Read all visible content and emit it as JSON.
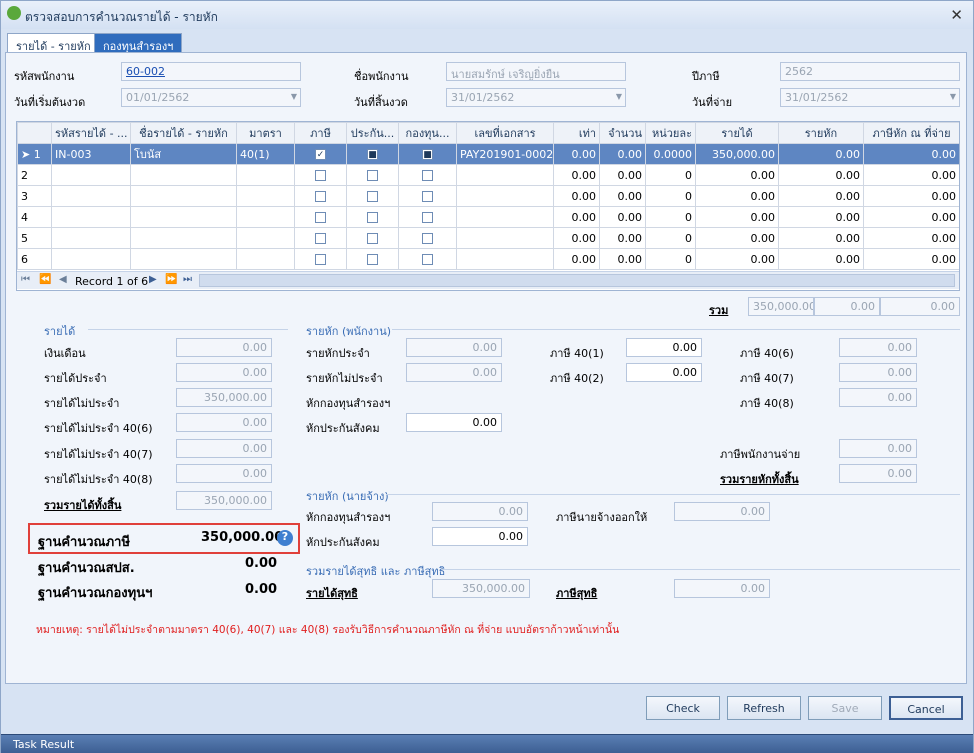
{
  "window": {
    "title": "ตรวจสอบการคำนวณรายได้ - รายหัก",
    "close": "✕"
  },
  "tabs": [
    {
      "label": "รายได้ - รายหัก"
    },
    {
      "label": "กองทุนสำรองฯ"
    }
  ],
  "header": {
    "emp_code_label": "รหัสพนักงาน",
    "emp_code": "60-002",
    "emp_name_label": "ชื่อพนักงาน",
    "emp_name": "นายสมรักษ์ เจริญยิ่งยืน",
    "tax_year_label": "ปีภาษี",
    "tax_year": "2562",
    "start_label": "วันที่เริ่มต้นงวด",
    "start": "01/01/2562",
    "end_label": "วันที่สิ้นงวด",
    "end": "31/01/2562",
    "pay_label": "วันที่จ่าย",
    "pay": "31/01/2562"
  },
  "grid": {
    "columns": [
      "รหัสรายได้ - ...",
      "ชื่อรายได้ - รายหัก",
      "มาตรา",
      "ภาษี",
      "ประกัน...",
      "กองทุน...",
      "เลขที่เอกสาร",
      "เท่า",
      "จำนวน",
      "หน่วยละ",
      "รายได้",
      "รายหัก",
      "ภาษีหัก ณ ที่จ่าย"
    ],
    "rows": [
      {
        "n": "1",
        "code": "IN-003",
        "name": "โบนัส",
        "sec": "40(1)",
        "tax": true,
        "ins": true,
        "fund": true,
        "doc": "PAY201901-0002",
        "times": "0.00",
        "qty": "0.00",
        "unit": "0.0000",
        "inc": "350,000.00",
        "ded": "0.00",
        "wht": "0.00"
      },
      {
        "n": "2",
        "code": "",
        "name": "",
        "sec": "",
        "tax": false,
        "ins": false,
        "fund": false,
        "doc": "",
        "times": "0.00",
        "qty": "0.00",
        "unit": "0",
        "inc": "0.00",
        "ded": "0.00",
        "wht": "0.00"
      },
      {
        "n": "3",
        "code": "",
        "name": "",
        "sec": "",
        "tax": false,
        "ins": false,
        "fund": false,
        "doc": "",
        "times": "0.00",
        "qty": "0.00",
        "unit": "0",
        "inc": "0.00",
        "ded": "0.00",
        "wht": "0.00"
      },
      {
        "n": "4",
        "code": "",
        "name": "",
        "sec": "",
        "tax": false,
        "ins": false,
        "fund": false,
        "doc": "",
        "times": "0.00",
        "qty": "0.00",
        "unit": "0",
        "inc": "0.00",
        "ded": "0.00",
        "wht": "0.00"
      },
      {
        "n": "5",
        "code": "",
        "name": "",
        "sec": "",
        "tax": false,
        "ins": false,
        "fund": false,
        "doc": "",
        "times": "0.00",
        "qty": "0.00",
        "unit": "0",
        "inc": "0.00",
        "ded": "0.00",
        "wht": "0.00"
      },
      {
        "n": "6",
        "code": "",
        "name": "",
        "sec": "",
        "tax": false,
        "ins": false,
        "fund": false,
        "doc": "",
        "times": "0.00",
        "qty": "0.00",
        "unit": "0",
        "inc": "0.00",
        "ded": "0.00",
        "wht": "0.00"
      }
    ],
    "record_text": "Record 1 of 6",
    "total_label": "รวม",
    "total_inc": "350,000.00",
    "total_ded": "0.00",
    "total_wht": "0.00"
  },
  "income": {
    "group": "รายได้",
    "salary_label": "เงินเดือน",
    "salary": "0.00",
    "regular_label": "รายได้ประจำ",
    "regular": "0.00",
    "irregular_label": "รายได้ไม่ประจำ",
    "irregular": "350,000.00",
    "ir406_label": "รายได้ไม่ประจำ 40(6)",
    "ir406": "0.00",
    "ir407_label": "รายได้ไม่ประจำ 40(7)",
    "ir407": "0.00",
    "ir408_label": "รายได้ไม่ประจำ 40(8)",
    "ir408": "0.00",
    "total_label": "รวมรายได้ทั้งสิ้น",
    "total": "350,000.00"
  },
  "bases": {
    "tax_label": "ฐานคำนวณภาษี",
    "tax": "350,000.00",
    "sso_label": "ฐานคำนวณสปส.",
    "sso": "0.00",
    "fund_label": "ฐานคำนวณกองทุนฯ",
    "fund": "0.00",
    "help": "?"
  },
  "emp_ded": {
    "group": "รายหัก (พนักงาน)",
    "regular_label": "รายหักประจำ",
    "regular": "0.00",
    "irregular_label": "รายหักไม่ประจำ",
    "irregular": "0.00",
    "fund_label": "หักกองทุนสำรองฯ",
    "fund": "",
    "sso_label": "หักประกันสังคม",
    "sso": "0.00",
    "t401_label": "ภาษี 40(1)",
    "t401": "0.00",
    "t402_label": "ภาษี 40(2)",
    "t402": "0.00",
    "t406_label": "ภาษี 40(6)",
    "t406": "0.00",
    "t407_label": "ภาษี 40(7)",
    "t407": "0.00",
    "t408_label": "ภาษี 40(8)",
    "t408": "0.00",
    "emp_tax_label": "ภาษีพนักงานจ่าย",
    "emp_tax": "0.00",
    "total_label": "รวมรายหักทั้งสิ้น",
    "total": "0.00"
  },
  "er_ded": {
    "group": "รายหัก (นายจ้าง)",
    "fund_label": "หักกองทุนสำรองฯ",
    "fund": "0.00",
    "sso_label": "หักประกันสังคม",
    "sso": "0.00",
    "er_tax_label": "ภาษีนายจ้างออกให้",
    "er_tax": "0.00"
  },
  "net": {
    "group": "รวมรายได้สุทธิ และ ภาษีสุทธิ",
    "income_label": "รายได้สุทธิ",
    "income": "350,000.00",
    "tax_label": "ภาษีสุทธิ",
    "tax": "0.00"
  },
  "note": "หมายเหตุ: รายได้ไม่ประจำตามมาตรา 40(6), 40(7) และ 40(8)  รองรับวิธีการคำนวณภาษีหัก ณ ที่จ่าย แบบอัตราก้าวหน้าเท่านั้น",
  "buttons": {
    "check": "Check",
    "refresh": "Refresh",
    "save": "Save",
    "cancel": "Cancel"
  },
  "status": {
    "task": "Task Result"
  }
}
